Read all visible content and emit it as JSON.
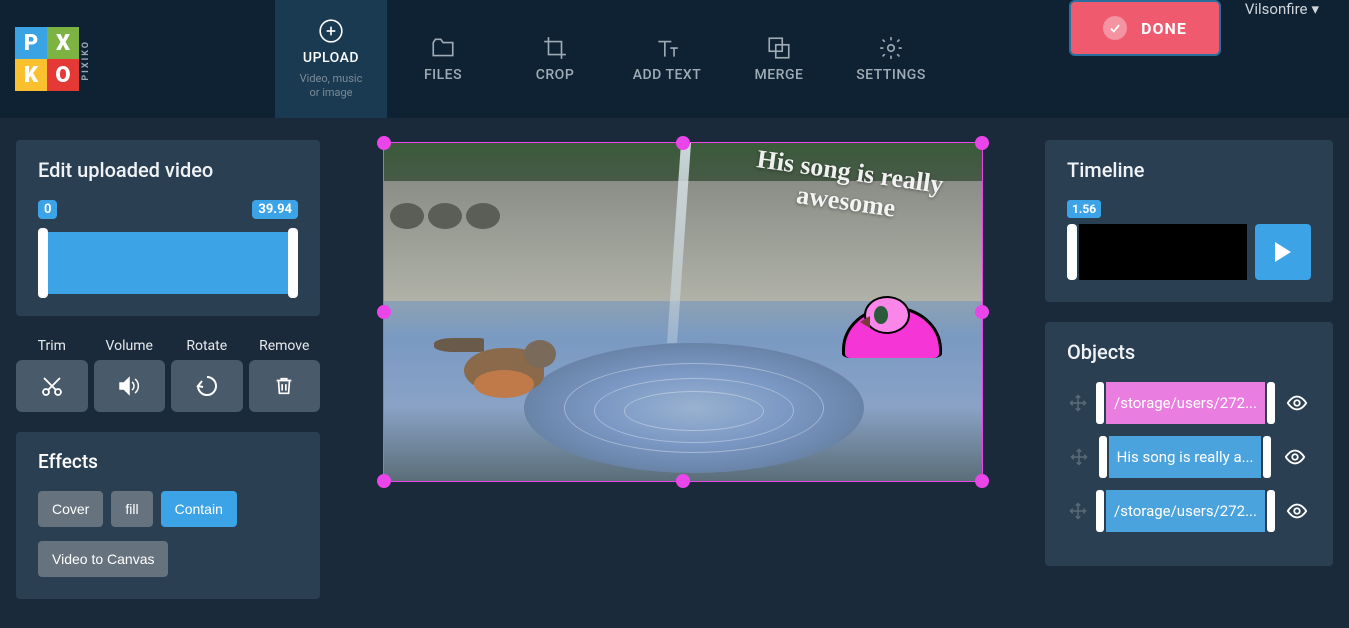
{
  "header": {
    "logo_text": "PIXIKO",
    "toolbar": [
      {
        "label": "UPLOAD",
        "sub": "Video, music\nor image"
      },
      {
        "label": "FILES"
      },
      {
        "label": "CROP"
      },
      {
        "label": "ADD TEXT"
      },
      {
        "label": "MERGE"
      },
      {
        "label": "SETTINGS"
      }
    ],
    "done": "DONE",
    "username": "Vilsonfire"
  },
  "left": {
    "edit_title": "Edit uploaded video",
    "range_start": "0",
    "range_end": "39.94",
    "actions": {
      "trim": "Trim",
      "volume": "Volume",
      "rotate": "Rotate",
      "remove": "Remove"
    },
    "effects_title": "Effects",
    "effects": {
      "cover": "Cover",
      "fill": "fill",
      "contain": "Contain",
      "video_to_canvas": "Video to Canvas"
    }
  },
  "canvas": {
    "overlay_text": "His song is really awesome"
  },
  "right": {
    "timeline_title": "Timeline",
    "timeline_pos": "1.56",
    "objects_title": "Objects",
    "objects": [
      {
        "label": "/storage/users/272...",
        "color": "pink"
      },
      {
        "label": "His song is really a...",
        "color": "blue"
      },
      {
        "label": "/storage/users/272...",
        "color": "blue"
      }
    ]
  }
}
